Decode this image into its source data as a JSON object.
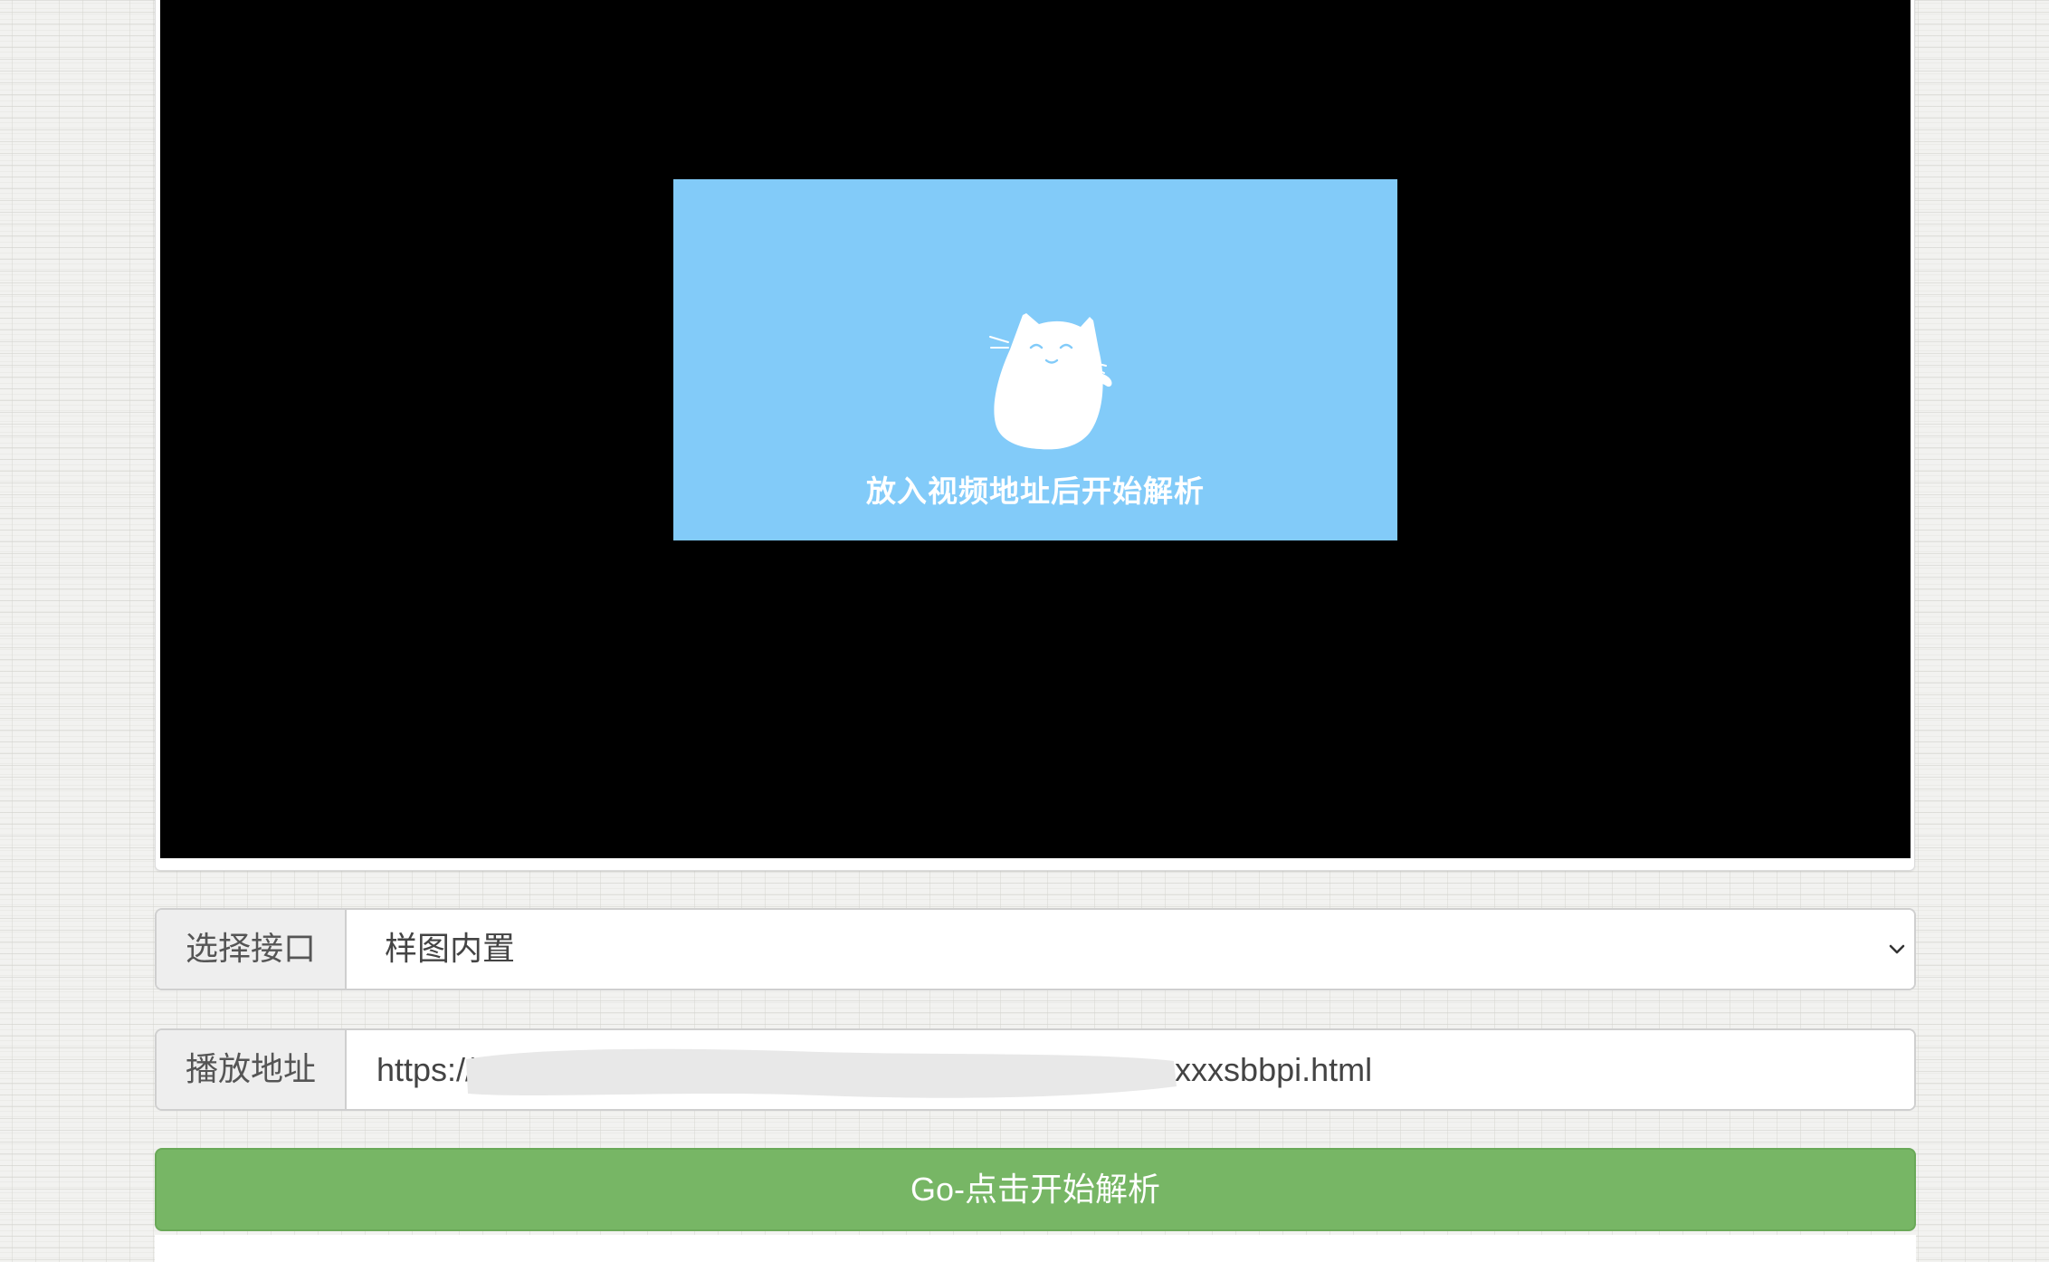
{
  "player": {
    "placeholder_text": "放入视频地址后开始解析",
    "placeholder_bg": "#82cbf9",
    "video_bg": "#000000",
    "mascot_icon": "cat-icon"
  },
  "api_select": {
    "label": "选择接口",
    "selected": "样图内置"
  },
  "url_field": {
    "label": "播放地址",
    "value": "https://xxxxxxxxxxxxxxxxxxxxxxxxxxxxxxxxxxxxxxxxxxxxxxsbbpi.html"
  },
  "go_button": {
    "label": "Go-点击开始解析",
    "color": "#77b665"
  }
}
